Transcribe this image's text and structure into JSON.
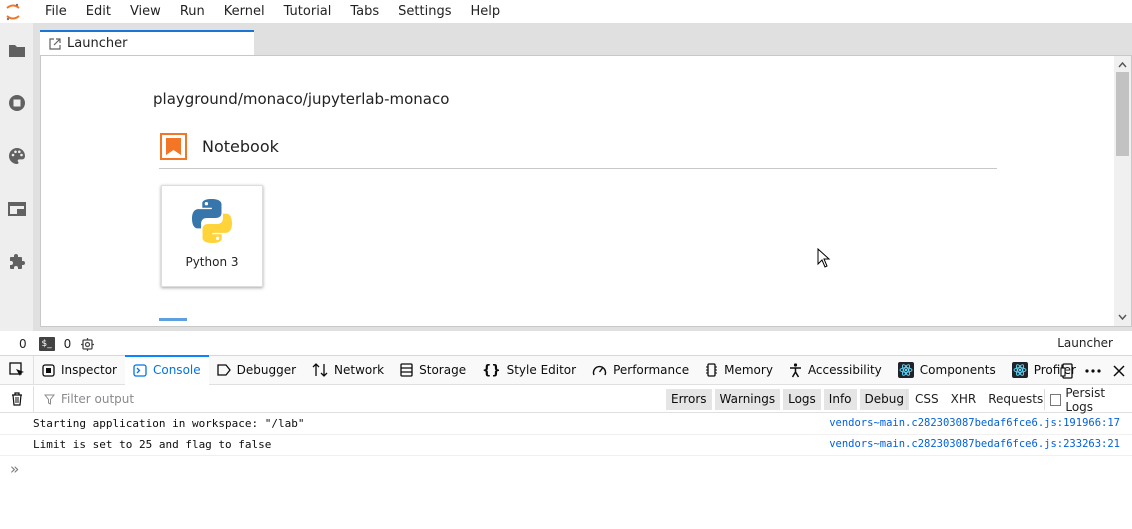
{
  "menu": [
    "File",
    "Edit",
    "View",
    "Run",
    "Kernel",
    "Tutorial",
    "Tabs",
    "Settings",
    "Help"
  ],
  "tab": {
    "label": "Launcher"
  },
  "launcher": {
    "cwd": "playground/monaco/jupyterlab-monaco",
    "section_title": "Notebook",
    "kernel_card": "Python 3"
  },
  "statusbar": {
    "left_count": "0",
    "terminal_label": "$_",
    "kernel_count": "0",
    "right_label": "Launcher"
  },
  "devtools": {
    "tabs": [
      "Inspector",
      "Console",
      "Debugger",
      "Network",
      "Storage",
      "Style Editor",
      "Performance",
      "Memory",
      "Accessibility",
      "Components",
      "Profiler"
    ],
    "selected_tab": "Console",
    "filter_placeholder": "Filter output",
    "levels": [
      "Errors",
      "Warnings",
      "Logs",
      "Info",
      "Debug"
    ],
    "categories": [
      "CSS",
      "XHR",
      "Requests"
    ],
    "persist_logs": "Persist Logs",
    "messages": [
      {
        "text": "Starting application in workspace: \"/lab\"",
        "location": "vendors~main.c282303087bedaf6fce6.js:191966:17"
      },
      {
        "text": "Limit is set to 25 and flag to false",
        "location": "vendors~main.c282303087bedaf6fce6.js:233263:21"
      }
    ],
    "prompt": "»"
  },
  "colors": {
    "accent": "#1976d2",
    "notebook_orange": "#f37626",
    "devtools_selected": "#0a84ff"
  }
}
